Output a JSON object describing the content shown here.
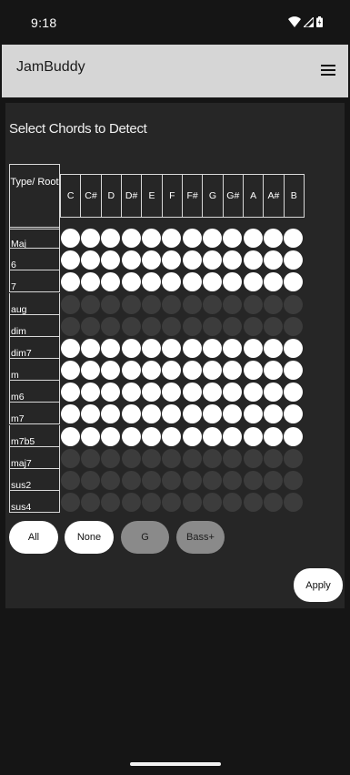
{
  "status": {
    "time": "9:18"
  },
  "app": {
    "title": "JamBuddy",
    "menu_icon": "hamburger-menu-icon"
  },
  "panel": {
    "title": "Select Chords to Detect"
  },
  "grid": {
    "corner_label": "Type/ Root",
    "roots": [
      "C",
      "C#",
      "D",
      "D#",
      "E",
      "F",
      "F#",
      "G",
      "G#",
      "A",
      "A#",
      "B"
    ],
    "types": [
      {
        "label": "Maj",
        "enabled": true
      },
      {
        "label": "6",
        "enabled": true
      },
      {
        "label": "7",
        "enabled": true
      },
      {
        "label": "aug",
        "enabled": false
      },
      {
        "label": "dim",
        "enabled": false
      },
      {
        "label": "dim7",
        "enabled": true
      },
      {
        "label": "m",
        "enabled": true
      },
      {
        "label": "m6",
        "enabled": true
      },
      {
        "label": "m7",
        "enabled": true
      },
      {
        "label": "m7b5",
        "enabled": true
      },
      {
        "label": "maj7",
        "enabled": false
      },
      {
        "label": "sus2",
        "enabled": false
      },
      {
        "label": "sus4",
        "enabled": false
      }
    ]
  },
  "buttons": {
    "all": "All",
    "none": "None",
    "g": "G",
    "bass": "Bass+",
    "apply": "Apply"
  },
  "colors": {
    "selected": "#ffffff",
    "unselected": "#3c3c3c",
    "app_bar": "#d6d6d6"
  }
}
